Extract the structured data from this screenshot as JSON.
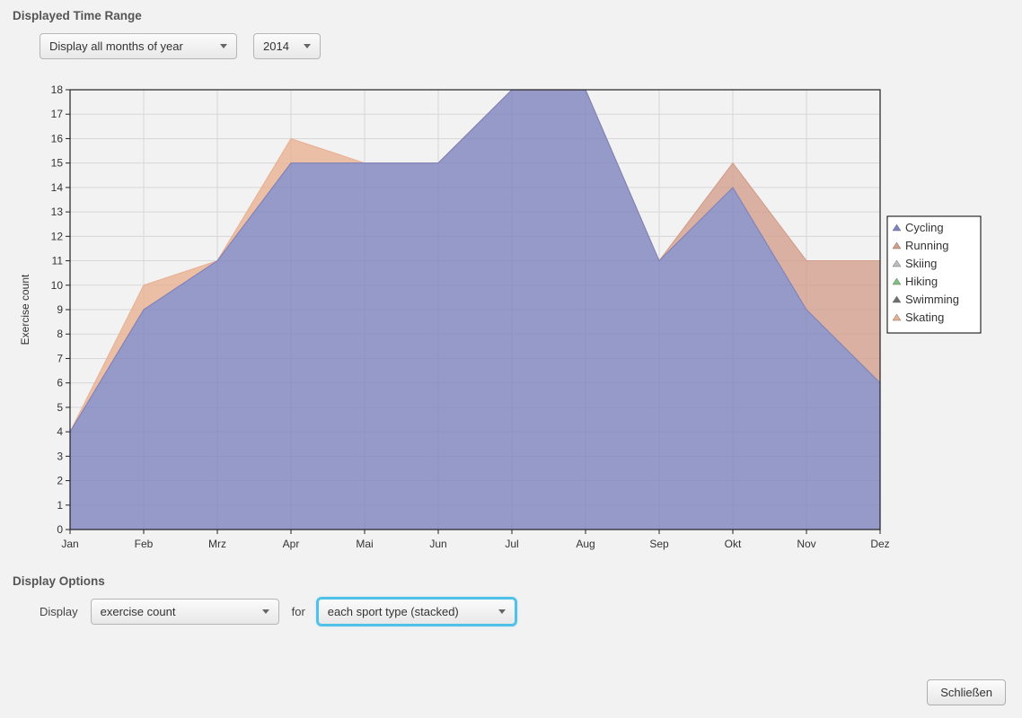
{
  "timeRange": {
    "title": "Displayed Time Range",
    "period": "Display all months of year",
    "year": "2014"
  },
  "displayOptions": {
    "title": "Display Options",
    "displayLabel": "Display",
    "metric": "exercise count",
    "forLabel": "for",
    "grouping": "each sport type (stacked)"
  },
  "buttons": {
    "close": "Schließen"
  },
  "axis": {
    "ylabel": "Exercise count"
  },
  "legend": {
    "items": [
      "Cycling",
      "Running",
      "Skiing",
      "Hiking",
      "Swimming",
      "Skating"
    ]
  },
  "chart_data": {
    "type": "area",
    "title": "",
    "xlabel": "",
    "ylabel": "Exercise count",
    "categories": [
      "Jan",
      "Feb",
      "Mrz",
      "Apr",
      "Mai",
      "Jun",
      "Jul",
      "Aug",
      "Sep",
      "Okt",
      "Nov",
      "Dez"
    ],
    "ylim": [
      0,
      18
    ],
    "yticks": [
      0,
      1,
      2,
      3,
      4,
      5,
      6,
      7,
      8,
      9,
      10,
      11,
      12,
      13,
      14,
      15,
      16,
      17,
      18
    ],
    "stacked": true,
    "series": [
      {
        "name": "Cycling",
        "color": "#7c82bd",
        "values": [
          4,
          9,
          11,
          15,
          15,
          15,
          18,
          18,
          11,
          14,
          9,
          6
        ]
      },
      {
        "name": "Running",
        "color": "#d29e8c",
        "values": [
          0,
          0,
          0,
          0,
          0,
          0,
          0,
          0,
          0,
          1,
          2,
          5
        ]
      },
      {
        "name": "Skiing",
        "color": "#bdbdbd",
        "values": [
          0,
          0,
          0,
          0,
          0,
          0,
          0,
          0,
          0,
          0,
          0,
          0
        ]
      },
      {
        "name": "Hiking",
        "color": "#7fbf7f",
        "values": [
          0,
          0,
          0,
          0,
          0,
          0,
          0,
          0,
          0,
          0,
          0,
          0
        ]
      },
      {
        "name": "Swimming",
        "color": "#6f6f6f",
        "values": [
          0,
          0,
          0,
          0,
          0,
          0,
          0,
          0,
          0,
          0,
          0,
          0
        ]
      },
      {
        "name": "Skating",
        "color": "#e9af91",
        "values": [
          0,
          1,
          0,
          1,
          0,
          0,
          0,
          0,
          0,
          0,
          0,
          0
        ]
      }
    ],
    "legend_position": "right",
    "grid": true
  }
}
